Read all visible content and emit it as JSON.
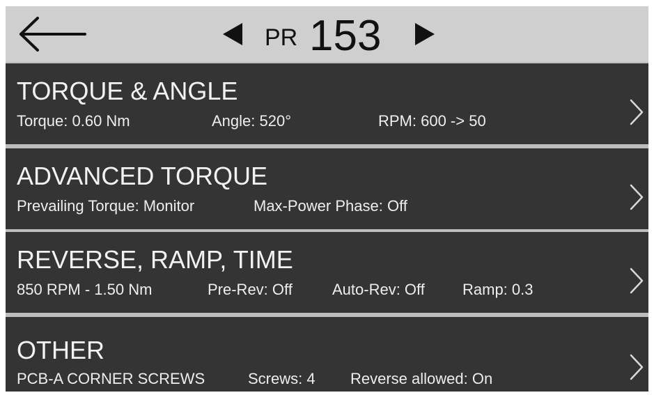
{
  "header": {
    "back_icon": "arrow-left-icon",
    "prev_icon": "triangle-left-icon",
    "next_icon": "triangle-right-icon",
    "pr_label": "PR",
    "pr_number": "153"
  },
  "rows": [
    {
      "title": "TORQUE & ANGLE",
      "details": [
        "Torque: 0.60 Nm",
        "Angle: 520°",
        "RPM: 600 -> 50"
      ]
    },
    {
      "title": "ADVANCED TORQUE",
      "details": [
        "Prevailing Torque: Monitor",
        "Max-Power Phase: Off"
      ]
    },
    {
      "title": "REVERSE, RAMP, TIME",
      "details": [
        "850 RPM - 1.50 Nm",
        "Pre-Rev: Off",
        "Auto-Rev: Off",
        "Ramp: 0.3"
      ]
    },
    {
      "title": "OTHER",
      "details": [
        "PCB-A CORNER SCREWS",
        "Screws: 4",
        "Reverse allowed: On"
      ]
    }
  ],
  "chevron_icon": "chevron-right-icon",
  "colors": {
    "header_bg": "#cfcfcf",
    "row_bg": "#343434",
    "row_text": "#f2f2f2",
    "separator": "#bdbdbd"
  }
}
